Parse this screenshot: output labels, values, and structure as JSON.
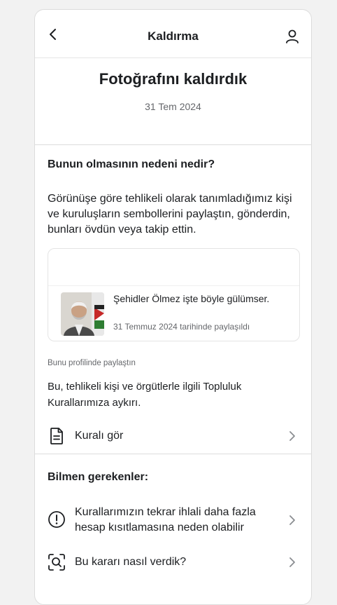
{
  "header": {
    "title": "Kaldırma",
    "back_icon": "chevron-left-icon",
    "profile_icon": "user-icon"
  },
  "main": {
    "title": "Fotoğrafını kaldırdık",
    "date": "31 Tem 2024"
  },
  "reason": {
    "heading": "Bunun olmasının nedeni nedir?",
    "body": "Görünüşe göre tehlikeli olarak tanımladığımız kişi ve kuruluşların sembollerini paylaştın, gönderdin, bunları övdün veya takip ettin."
  },
  "post": {
    "caption": "Şehidler Ölmez işte böyle gülümser.",
    "shared_date": "31 Temmuz 2024 tarihinde paylaşıldı",
    "thumbnail_icon": "photo-thumbnail"
  },
  "shared_note": "Bunu profilinde paylaştın",
  "rule_text": "Bu, tehlikeli kişi ve örgütlerle ilgili Topluluk Kurallarımıza aykırı.",
  "view_rule": {
    "label": "Kuralı gör",
    "icon": "document-icon"
  },
  "know": {
    "heading": "Bilmen gerekenler:",
    "items": [
      {
        "label": "Kurallarımızın tekrar ihlali daha fazla hesap kısıtlamasına neden olabilir",
        "icon": "alert-circle-icon"
      },
      {
        "label": "Bu kararı nasıl verdik?",
        "icon": "scan-search-icon"
      }
    ]
  },
  "colors": {
    "text": "#1c1e21",
    "secondary": "#65676b",
    "divider": "#dcdcdc",
    "background": "#f2f2f2"
  }
}
